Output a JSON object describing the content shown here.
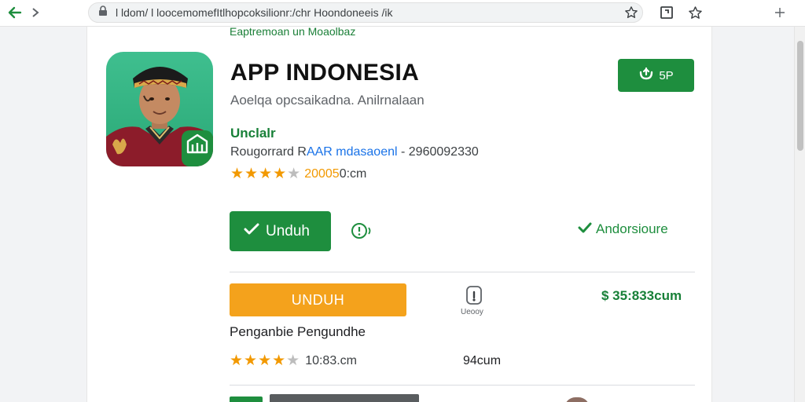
{
  "browser": {
    "url": "l ldom/ l loocemomefItlhopcoksilionr:/chr Hoondoneeis /ik"
  },
  "header": {
    "cut_text": "Eaptremoan un Moaolbaz"
  },
  "app": {
    "title": "APP INDONESIA",
    "subtitle": "Aoelqa opcsaikadna. Anilrnalaan",
    "developer": "Unclalr",
    "meta_prefix": "Rougorrard R",
    "meta_link": "AAR mdasaoenl",
    "meta_suffix": " - 2960092330",
    "rating_count": "20005",
    "rating_unit": " 0:cm",
    "stars": 4
  },
  "top_button": {
    "label": "5P"
  },
  "actions": {
    "install_label": "Unduh",
    "verified_label": "Andorsioure"
  },
  "download_section": {
    "button_label": "UNDUH",
    "lock_caption": "Ueooy",
    "price": "$ 35:833cum",
    "title": "Penganbie Pengundhe",
    "rating_text": "10:83.cm",
    "stars": 4,
    "size": "94cum"
  },
  "colors": {
    "brand_green": "#1e8e3e",
    "accent_orange": "#f4a21c",
    "star_gold": "#f29900"
  }
}
